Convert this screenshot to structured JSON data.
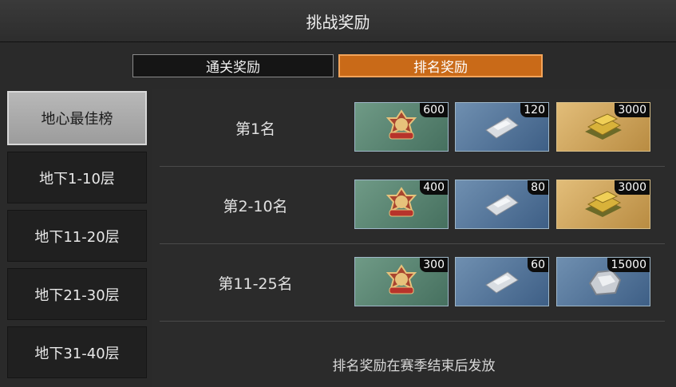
{
  "title": "挑战奖励",
  "tabs": [
    {
      "label": "通关奖励",
      "active": false
    },
    {
      "label": "排名奖励",
      "active": true
    }
  ],
  "sidebar": {
    "items": [
      {
        "label": "地心最佳榜",
        "selected": true
      },
      {
        "label": "地下1-10层"
      },
      {
        "label": "地下11-20层"
      },
      {
        "label": "地下21-30层"
      },
      {
        "label": "地下31-40层"
      }
    ]
  },
  "rows": [
    {
      "rank": "第1名",
      "rewards": [
        {
          "icon": "rescue-medal-icon",
          "qty": "600"
        },
        {
          "icon": "ticket-pack-icon",
          "qty": "120"
        },
        {
          "icon": "gold-bars-icon",
          "qty": "3000"
        }
      ]
    },
    {
      "rank": "第2-10名",
      "rewards": [
        {
          "icon": "rescue-medal-icon",
          "qty": "400"
        },
        {
          "icon": "ticket-pack-icon",
          "qty": "80"
        },
        {
          "icon": "gold-bars-icon",
          "qty": "3000"
        }
      ]
    },
    {
      "rank": "第11-25名",
      "rewards": [
        {
          "icon": "rescue-medal-icon",
          "qty": "300"
        },
        {
          "icon": "ticket-pack-icon",
          "qty": "60"
        },
        {
          "icon": "silver-ore-icon",
          "qty": "15000"
        }
      ]
    }
  ],
  "footer_note": "排名奖励在赛季结束后发放",
  "colors": {
    "accent": "#c96a18",
    "background": "#2a2a2a"
  }
}
